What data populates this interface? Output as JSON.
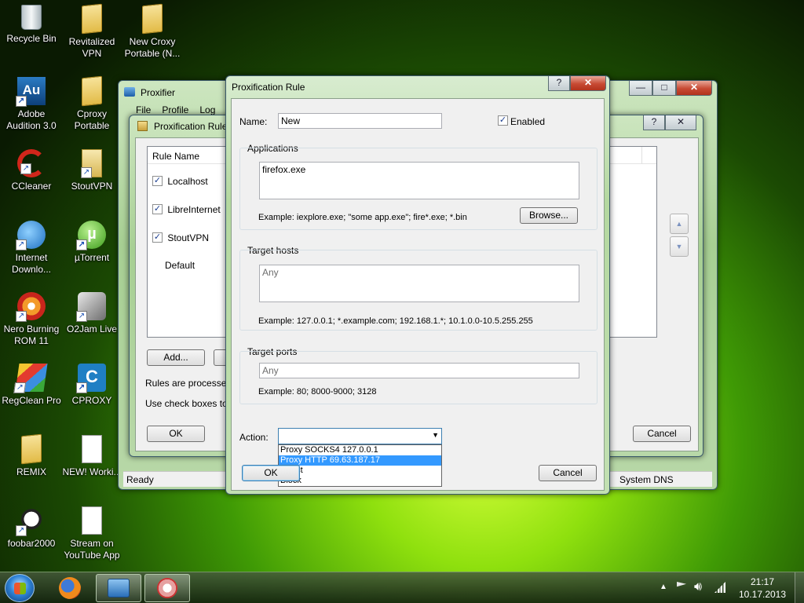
{
  "desktop": {
    "icons": [
      {
        "label": "Recycle Bin",
        "icon": "recycle-bin-icon"
      },
      {
        "label": "Revitalized VPN",
        "icon": "folder-icon"
      },
      {
        "label": "New Croxy Portable (N...",
        "icon": "folder-icon"
      },
      {
        "label": "Adobe Audition 3.0",
        "icon": "adobe-audition-icon"
      },
      {
        "label": "Cproxy Portable",
        "icon": "folder-icon"
      },
      {
        "label": "CCleaner",
        "icon": "ccleaner-icon"
      },
      {
        "label": "StoutVPN",
        "icon": "stoutvpn-icon"
      },
      {
        "label": "Internet Downlo...",
        "icon": "internet-download-manager-icon"
      },
      {
        "label": "µTorrent",
        "icon": "utorrent-icon"
      },
      {
        "label": "Nero Burning ROM 11",
        "icon": "nero-icon"
      },
      {
        "label": "O2Jam Live",
        "icon": "o2jam-icon"
      },
      {
        "label": "RegClean Pro",
        "icon": "regclean-icon"
      },
      {
        "label": "CPROXY",
        "icon": "cproxy-icon"
      },
      {
        "label": "REMIX",
        "icon": "folder-icon"
      },
      {
        "label": "NEW! Worki...",
        "icon": "text-file-icon"
      },
      {
        "label": "foobar2000",
        "icon": "foobar-icon"
      },
      {
        "label": "Stream on YouTube App",
        "icon": "text-file-icon"
      }
    ]
  },
  "proxifier": {
    "title": "Proxifier",
    "menu": [
      "File",
      "Profile",
      "Log"
    ],
    "status_left": "Ready",
    "status_right": "System DNS"
  },
  "rules_dialog": {
    "title": "Proxification Rules",
    "column_rule_name": "Rule Name",
    "rules": [
      {
        "name": "Localhost",
        "checked": true
      },
      {
        "name": "LibreInternet",
        "checked": true
      },
      {
        "name": "StoutVPN",
        "checked": true
      },
      {
        "name": "Default",
        "checked": false
      }
    ],
    "add_label": "Add...",
    "note1": "Rules are processed f",
    "note2": "Use check boxes to e",
    "ok_label": "OK",
    "cancel_label": "Cancel"
  },
  "rule_dialog": {
    "title": "Proxification Rule",
    "help": "?",
    "close": "✕",
    "name_label": "Name:",
    "name_value": "New",
    "enabled_label": "Enabled",
    "enabled": true,
    "applications_label": "Applications",
    "applications_value": "firefox.exe",
    "applications_example": "Example: iexplore.exe; \"some app.exe\"; fire*.exe; *.bin",
    "browse_label": "Browse...",
    "target_hosts_label": "Target hosts",
    "target_hosts_value": "Any",
    "target_hosts_example": "Example: 127.0.0.1; *.example.com; 192.168.1.*; 10.1.0.0-10.5.255.255",
    "target_ports_label": "Target ports",
    "target_ports_value": "Any",
    "target_ports_example": "Example: 80; 8000-9000; 3128",
    "action_label": "Action:",
    "action_selected": "",
    "action_options": [
      "Proxy SOCKS4 127.0.0.1",
      "Proxy HTTP 69.63.187.17",
      "Direct",
      "Block"
    ],
    "action_highlighted_index": 1,
    "ok_label": "OK",
    "cancel_label": "Cancel"
  },
  "taskbar": {
    "start_icon": "windows-start-orb-icon",
    "pinned": [
      "firefox-icon",
      "proxifier-icon",
      "network-tool-icon"
    ],
    "clock_time": "21:17",
    "clock_date": "10.17.2013"
  },
  "colors": {
    "selection": "#3399ff",
    "aero_frame": "#a7cf93"
  }
}
